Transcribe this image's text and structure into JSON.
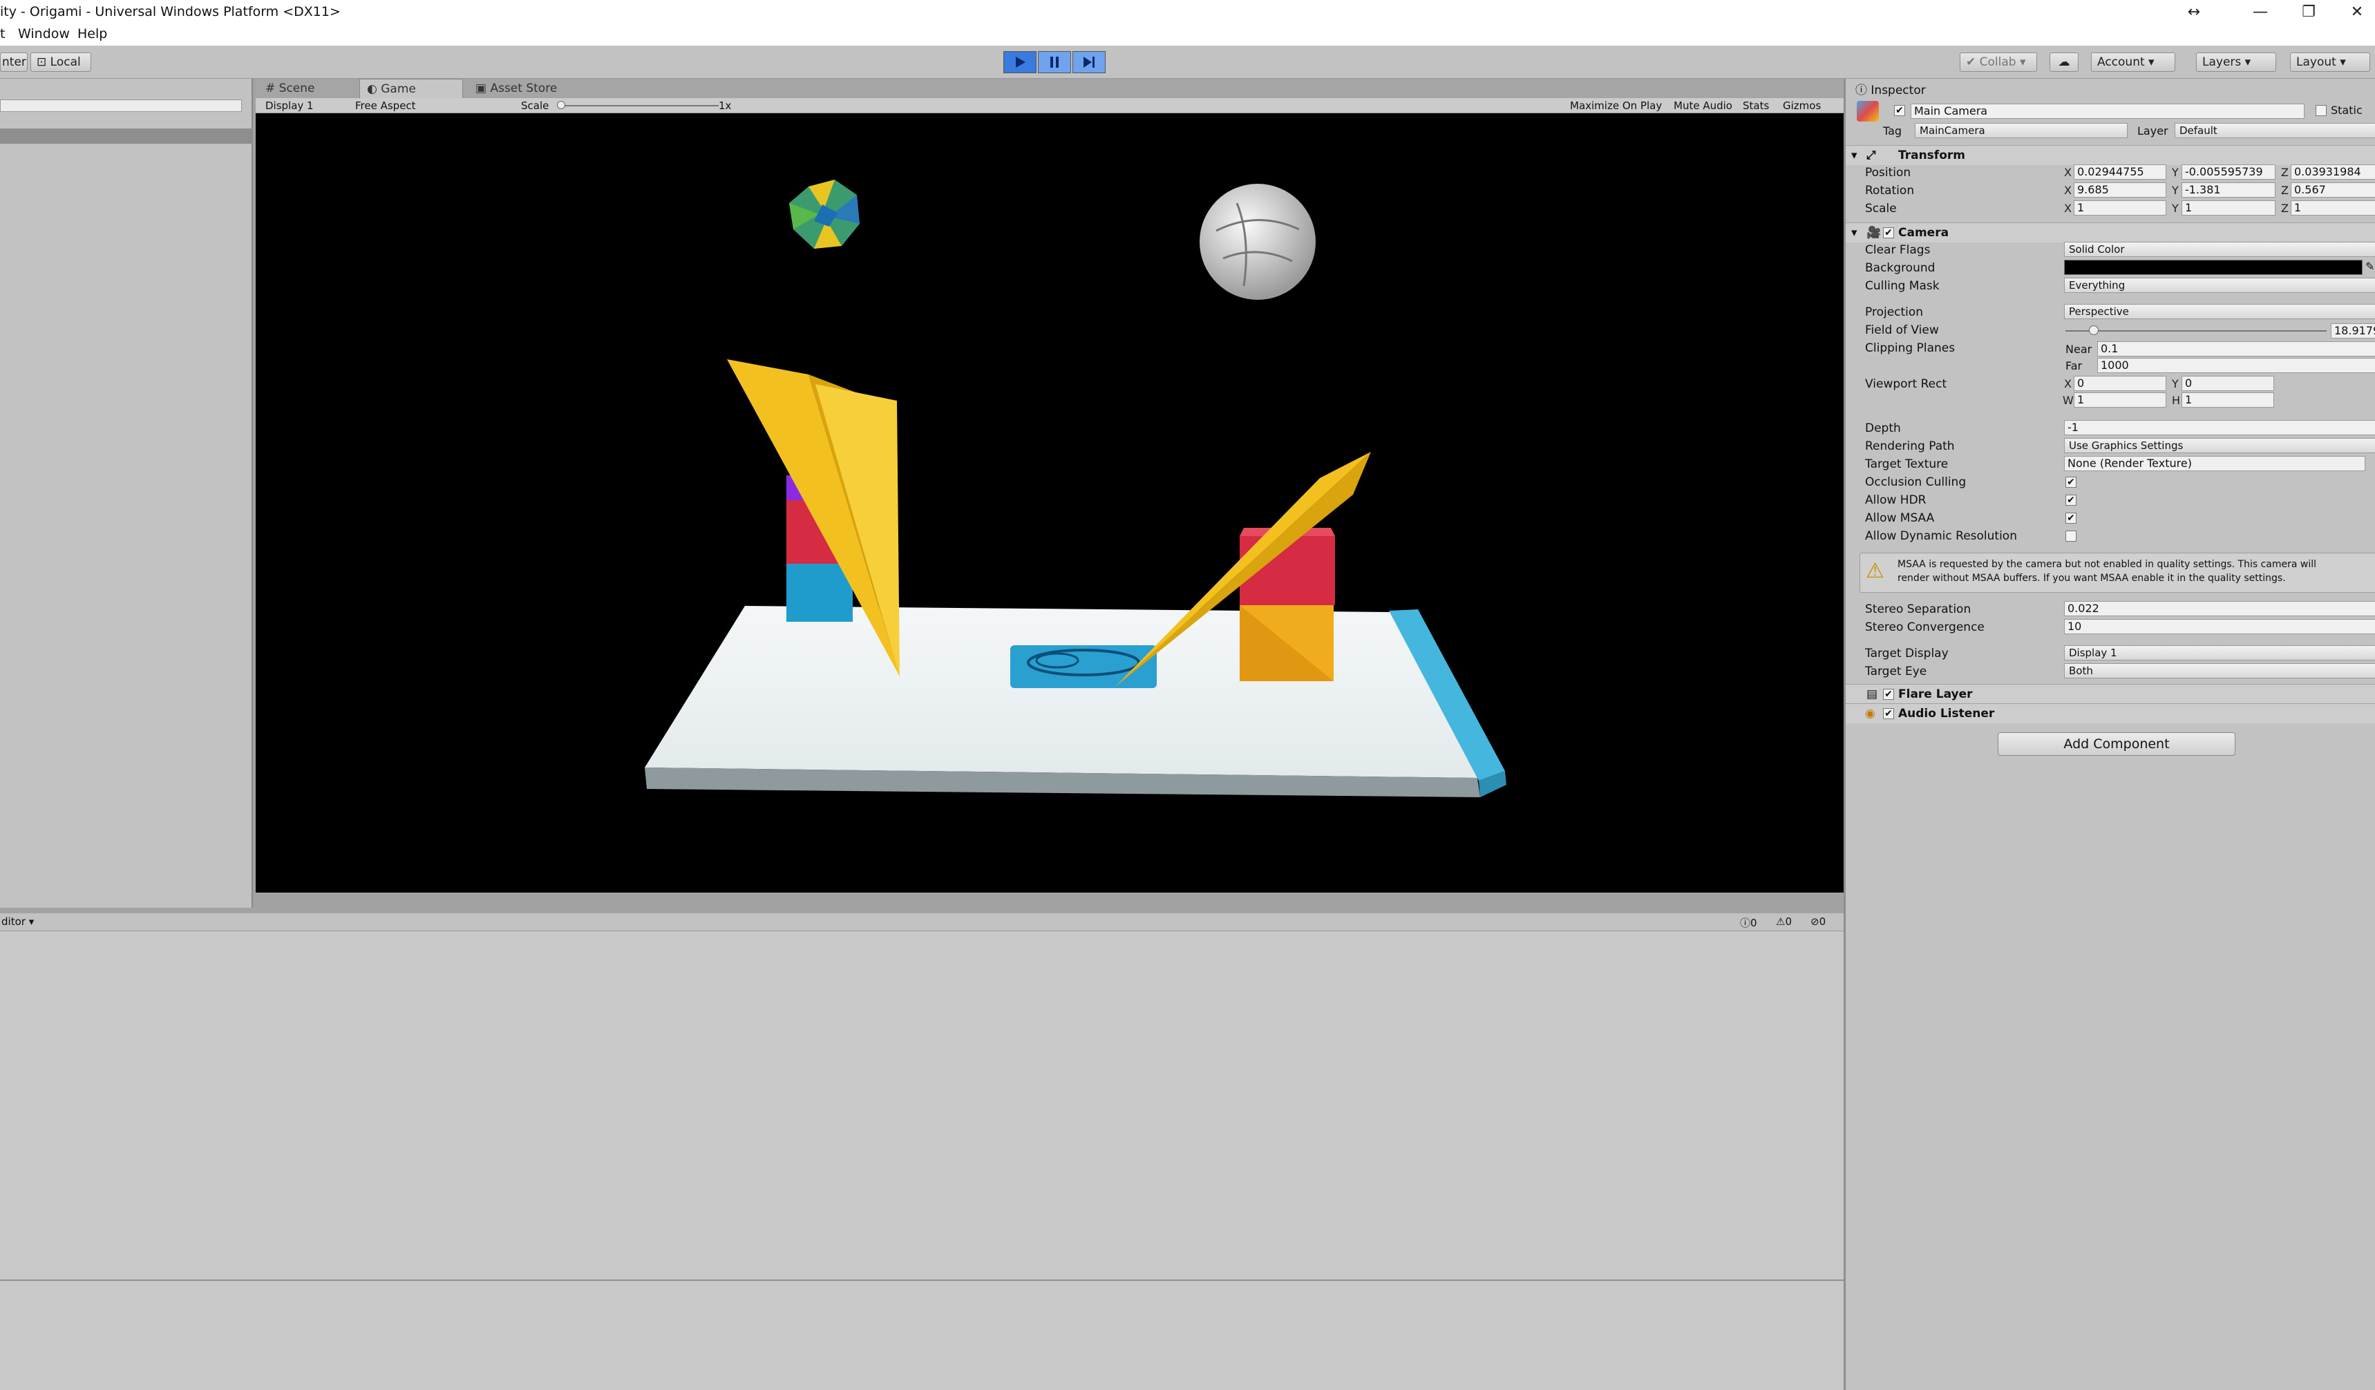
{
  "window": {
    "title": "ity - Origami - Universal Windows Platform <DX11>",
    "resize_icon": "↔",
    "minimize_icon": "—",
    "restore_icon": "❐",
    "close_icon": "✕"
  },
  "menu": {
    "items": [
      "t",
      "Window",
      "Help"
    ]
  },
  "toolbar": {
    "pivot_center": "nter",
    "pivot_local": "Local",
    "collab": "Collab",
    "account": "Account",
    "layers": "Layers",
    "layout": "Layout",
    "accent": "#3a7be0"
  },
  "tabs": {
    "scene": "Scene",
    "game": "Game",
    "asset_store": "Asset Store",
    "inspector": "Inspector"
  },
  "game_toolbar": {
    "display": "Display 1",
    "aspect": "Free Aspect",
    "scale_label": "Scale",
    "scale_value": "1x",
    "maximize": "Maximize On Play",
    "mute": "Mute Audio",
    "stats": "Stats",
    "gizmos": "Gizmos"
  },
  "console": {
    "editor_label": "ditor",
    "info_count": "0",
    "warn_count": "0",
    "error_count": "0"
  },
  "inspector": {
    "object_name": "Main Camera",
    "static_label": "Static",
    "tag_label": "Tag",
    "tag_value": "MainCamera",
    "layer_label": "Layer",
    "layer_value": "Default",
    "transform": {
      "title": "Transform",
      "position_label": "Position",
      "rotation_label": "Rotation",
      "scale_label": "Scale",
      "position": [
        "0.02944755",
        "-0.005595739",
        "0.03931984"
      ],
      "rotation": [
        "9.685",
        "-1.381",
        "0.567"
      ],
      "scale": [
        "1",
        "1",
        "1"
      ]
    },
    "camera": {
      "title": "Camera",
      "clear_flags_label": "Clear Flags",
      "clear_flags": "Solid Color",
      "background_label": "Background",
      "culling_mask_label": "Culling Mask",
      "culling_mask": "Everything",
      "projection_label": "Projection",
      "projection": "Perspective",
      "fov_label": "Field of View",
      "fov": "18.9179",
      "clipping_label": "Clipping Planes",
      "near_label": "Near",
      "near": "0.1",
      "far_label": "Far",
      "far": "1000",
      "viewport_label": "Viewport Rect",
      "vx": "0",
      "vy": "0",
      "vw": "1",
      "vh": "1",
      "depth_label": "Depth",
      "depth": "-1",
      "rendering_path_label": "Rendering Path",
      "rendering_path": "Use Graphics Settings",
      "target_texture_label": "Target Texture",
      "target_texture": "None (Render Texture)",
      "occlusion_label": "Occlusion Culling",
      "hdr_label": "Allow HDR",
      "msaa_label": "Allow MSAA",
      "dynres_label": "Allow Dynamic Resolution",
      "warning_line1": "MSAA is requested by the camera but not enabled in quality settings. This camera will",
      "warning_line2": "render without MSAA buffers. If you want MSAA enable it in the quality settings.",
      "stereo_sep_label": "Stereo Separation",
      "stereo_sep": "0.022",
      "stereo_conv_label": "Stereo Convergence",
      "stereo_conv": "10",
      "target_display_label": "Target Display",
      "target_display": "Display 1",
      "target_eye_label": "Target Eye",
      "target_eye": "Both"
    },
    "flare_layer": "Flare Layer",
    "audio_listener": "Audio Listener",
    "add_component": "Add Component",
    "axis": {
      "x": "X",
      "y": "Y",
      "z": "Z",
      "w": "W",
      "h": "H"
    }
  }
}
